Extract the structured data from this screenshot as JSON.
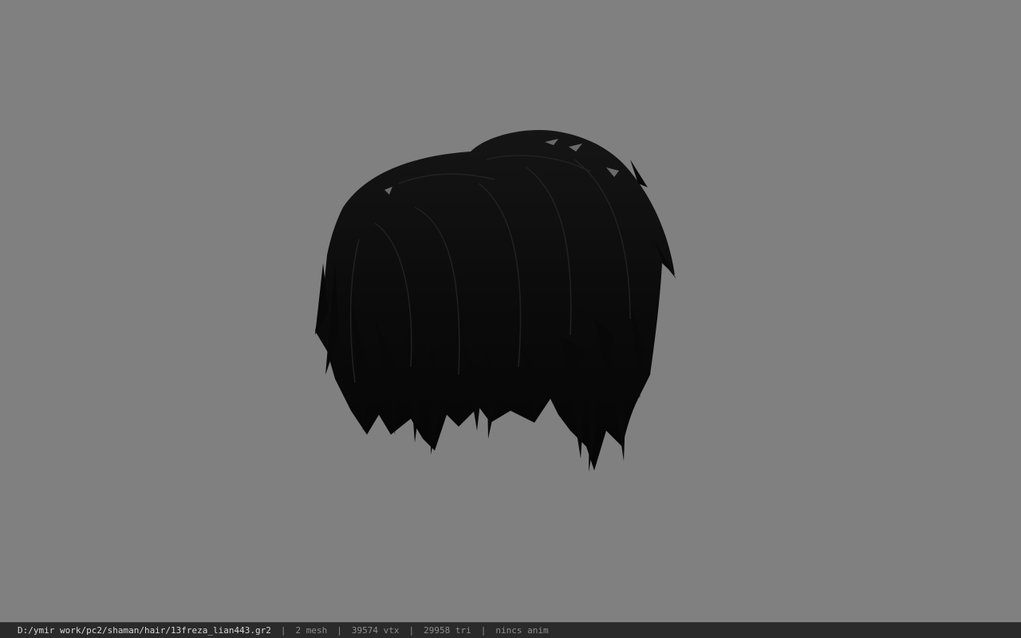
{
  "viewport": {
    "background": "#808080",
    "model": "hair-mesh"
  },
  "status": {
    "path": "D:/ymir work/pc2/shaman/hair/13freza_lian443.gr2",
    "separator": "|",
    "mesh": "2 mesh",
    "vertices": "39574 vtx",
    "triangles": "29958 tri",
    "anim": "nincs anim"
  },
  "colors": {
    "hair": "#0c0c0c",
    "hair_highlight": "#2a2a2a",
    "skin": "#b07860",
    "statusbar": "#2a2a2a"
  }
}
